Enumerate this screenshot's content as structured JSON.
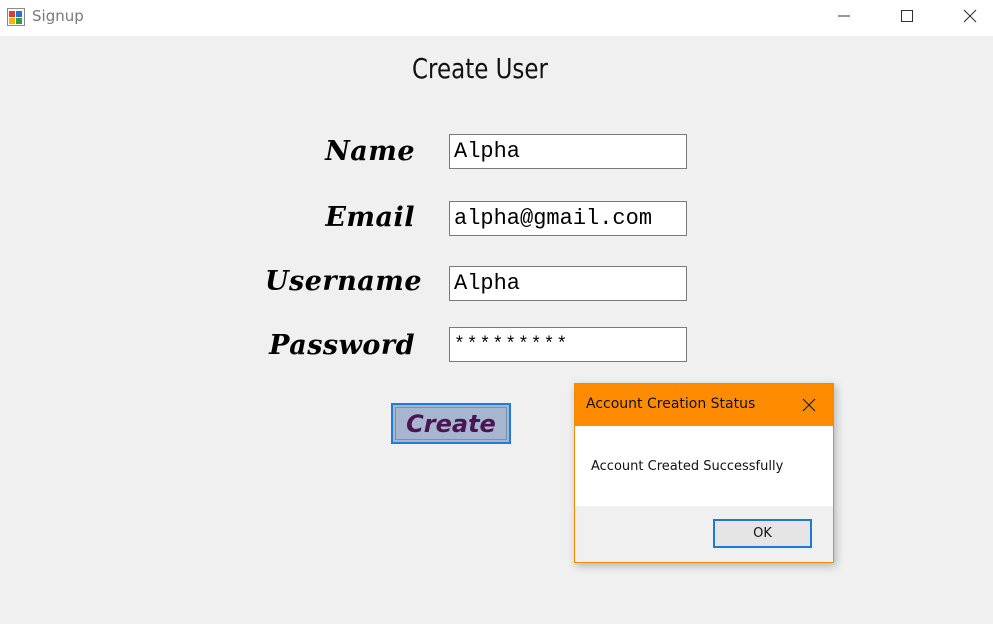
{
  "window": {
    "title": "Signup",
    "icons": {
      "app": "windows-form-icon",
      "minimize": "minimize-icon",
      "maximize": "maximize-icon",
      "close": "close-icon"
    }
  },
  "form": {
    "title": "Create User",
    "fields": {
      "name": {
        "label": "Name",
        "value": "Alpha"
      },
      "email": {
        "label": "Email",
        "value": "alpha@gmail.com"
      },
      "username": {
        "label": "Username",
        "value": "Alpha"
      },
      "password": {
        "label": "Password",
        "value": "*********"
      }
    },
    "create_button": "Create"
  },
  "dialog": {
    "title": "Account Creation Status",
    "message": "Account Created Successfully",
    "ok_button": "OK"
  },
  "colors": {
    "dialog_accent": "#ff8c00",
    "create_button_text": "#4a1452",
    "focus_border": "#1e7be0"
  }
}
